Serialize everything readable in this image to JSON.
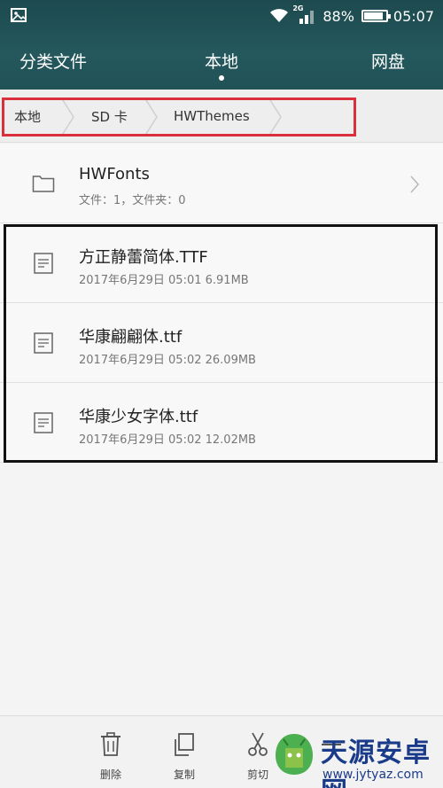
{
  "status": {
    "battery": "88%",
    "time": "05:07",
    "network": "2G",
    "battery_level": 0.88
  },
  "tabs": [
    {
      "label": "分类文件"
    },
    {
      "label": "本地"
    },
    {
      "label": "网盘"
    }
  ],
  "breadcrumb": [
    {
      "label": "本地"
    },
    {
      "label": "SD 卡"
    },
    {
      "label": "HWThemes"
    }
  ],
  "folder": {
    "name": "HWFonts",
    "meta": "文件：1，文件夹：0"
  },
  "files": [
    {
      "name": "方正静蕾简体.TTF",
      "meta": "2017年6月29日 05:01 6.91MB"
    },
    {
      "name": "华康翩翩体.ttf",
      "meta": "2017年6月29日 05:02 26.09MB"
    },
    {
      "name": "华康少女字体.ttf",
      "meta": "2017年6月29日 05:02 12.02MB"
    }
  ],
  "actions": [
    {
      "label": "删除"
    },
    {
      "label": "复制"
    },
    {
      "label": "剪切"
    },
    {
      "label": ""
    }
  ],
  "watermark": {
    "title": "天源安卓网",
    "url": "www.jytyaz.com"
  },
  "colors": {
    "header": "#24585c",
    "highlight_red": "#d9303b",
    "highlight_black": "#111111"
  }
}
